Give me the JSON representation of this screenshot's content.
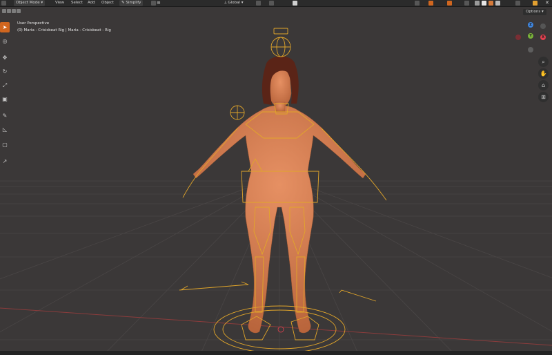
{
  "header": {
    "mode": "Object Mode",
    "menu": [
      "View",
      "Select",
      "Add",
      "Object"
    ],
    "simplify": "Simplify",
    "transform_orientation": "Global"
  },
  "toolbar": {
    "options": "Options"
  },
  "viewport": {
    "perspective": "User Perspective",
    "object": "(0) Maria - Crisisbeat Rig | Maria - Crisisbeat - Rig"
  },
  "gizmo": {
    "x": "X",
    "y": "Y",
    "z": "Z"
  },
  "colors": {
    "accent": "#d0661f",
    "rig": "#e2a62a",
    "skin": "#d9814f",
    "x_axis": "#e2404f",
    "y_axis": "#7ab33a",
    "z_axis": "#3f86e0"
  }
}
